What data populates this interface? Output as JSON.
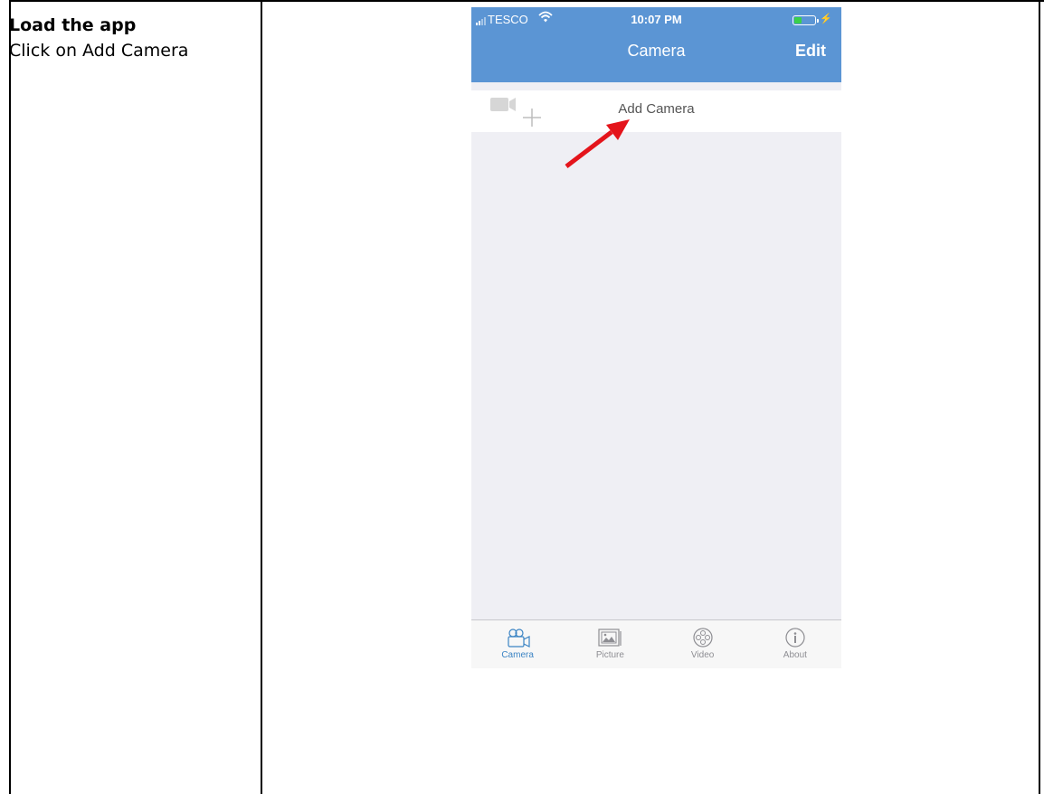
{
  "document": {
    "step_title": "Load the app",
    "step_description": "Click on Add Camera"
  },
  "phone": {
    "status_bar": {
      "carrier": "TESCO",
      "time": "10:07 PM"
    },
    "nav_bar": {
      "title": "Camera",
      "edit_label": "Edit"
    },
    "add_row_label": "Add Camera",
    "tabs": [
      {
        "label": "Camera",
        "icon": "video-camera-icon",
        "active": true
      },
      {
        "label": "Picture",
        "icon": "picture-icon",
        "active": false
      },
      {
        "label": "Video",
        "icon": "film-reel-icon",
        "active": false
      },
      {
        "label": "About",
        "icon": "info-icon",
        "active": false
      }
    ],
    "colors": {
      "nav_bar": "#5b95d4",
      "active_tab": "#3b84c4",
      "annotation_arrow": "#e4141b"
    }
  }
}
